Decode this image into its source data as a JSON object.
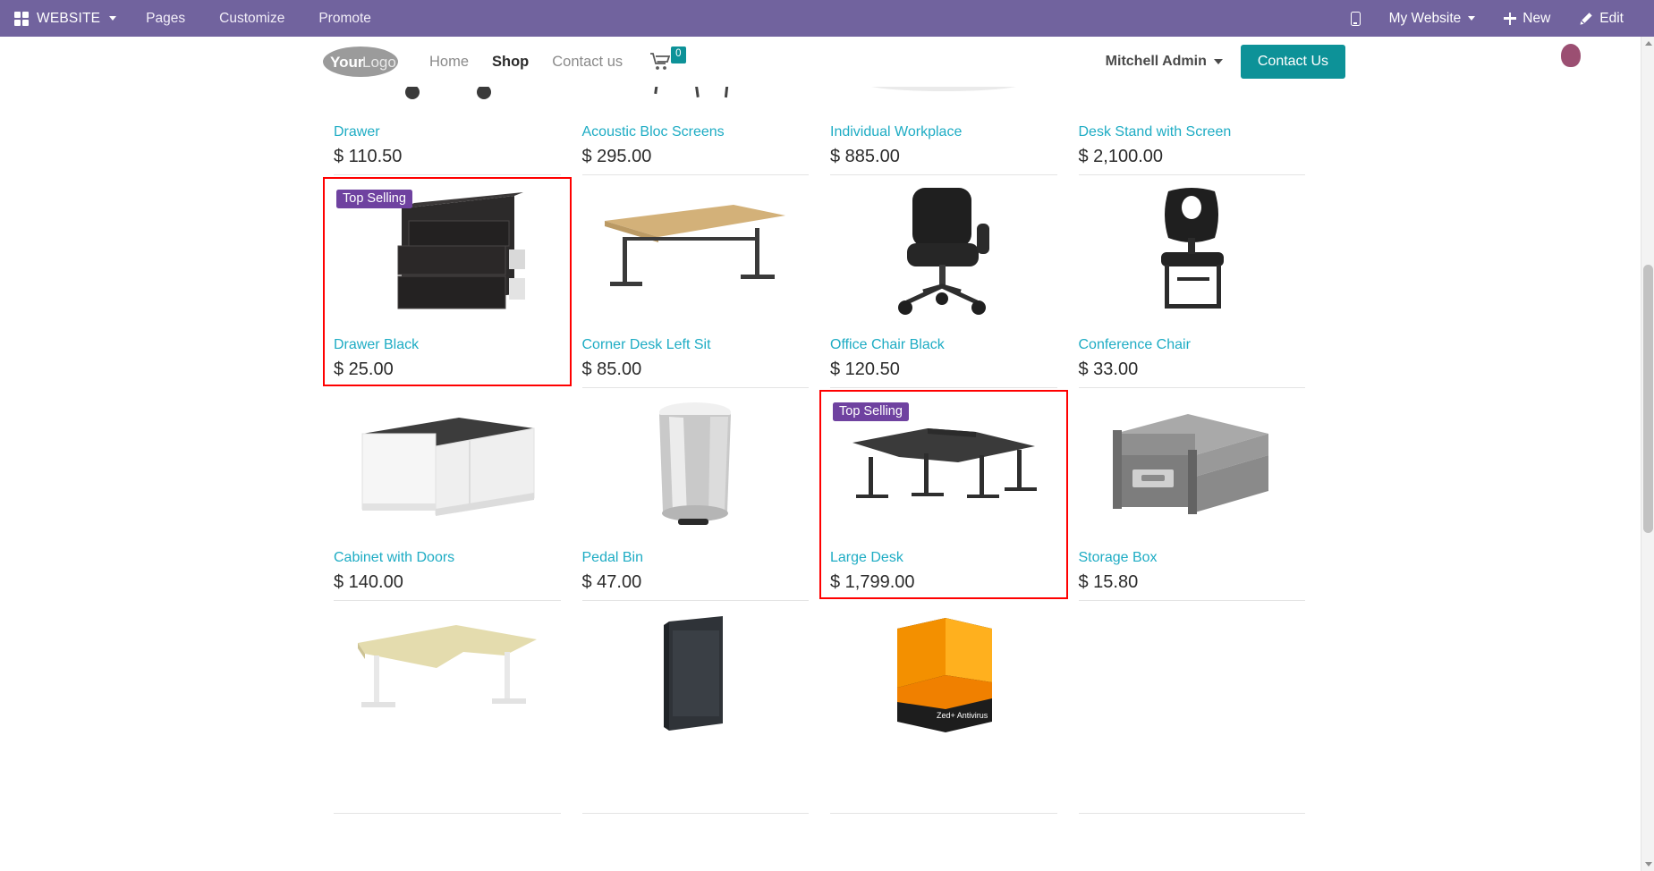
{
  "editor_bar": {
    "brand": {
      "icon": "grid-icon",
      "label": "WEBSITE"
    },
    "menu_items": [
      {
        "label": "Pages"
      },
      {
        "label": "Customize"
      },
      {
        "label": "Promote"
      }
    ],
    "right_items": [
      {
        "icon": "mobile-preview-icon",
        "label": ""
      },
      {
        "label": "My Website",
        "icon": "chevron-down-icon"
      },
      {
        "icon": "plus-icon",
        "label": "New"
      },
      {
        "icon": "pencil-icon",
        "label": "Edit"
      }
    ],
    "background_color": "#71639e"
  },
  "site_header": {
    "logo_text_bold": "Your",
    "logo_text_light": "Logo",
    "nav": [
      {
        "label": "Home",
        "active": false
      },
      {
        "label": "Shop",
        "active": true
      },
      {
        "label": "Contact us",
        "active": false
      }
    ],
    "cart": {
      "icon": "shopping-cart-icon",
      "count": "0",
      "badge_color": "#0d9298"
    },
    "user": {
      "name": "Mitchell Admin"
    },
    "cta_button": {
      "label": "Contact Us",
      "color": "#0d9298"
    }
  },
  "shop": {
    "accent_color": "#1eacc4",
    "badge_color": "#6f42a0",
    "highlight_color": "#ff0000",
    "rows": [
      {
        "products": [
          {
            "name": "Drawer",
            "price": "$ 110.50",
            "badge": "",
            "highlighted": false,
            "image": "drawer-white"
          },
          {
            "name": "Acoustic Bloc Screens",
            "price": "$ 295.00",
            "badge": "",
            "highlighted": false,
            "image": "acoustic-screens"
          },
          {
            "name": "Individual Workplace",
            "price": "$ 885.00",
            "badge": "",
            "highlighted": false,
            "image": "pink-booth"
          },
          {
            "name": "Desk Stand with Screen",
            "price": "$ 2,100.00",
            "badge": "",
            "highlighted": false,
            "image": "desk-stand-screen"
          }
        ]
      },
      {
        "products": [
          {
            "name": "Drawer Black",
            "price": "$ 25.00",
            "badge": "Top Selling",
            "highlighted": true,
            "image": "drawer-black"
          },
          {
            "name": "Corner Desk Left Sit",
            "price": "$ 85.00",
            "badge": "",
            "highlighted": false,
            "image": "corner-desk"
          },
          {
            "name": "Office Chair Black",
            "price": "$ 120.50",
            "badge": "",
            "highlighted": false,
            "image": "office-chair"
          },
          {
            "name": "Conference Chair",
            "price": "$ 33.00",
            "badge": "",
            "highlighted": false,
            "image": "conference-chair"
          }
        ]
      },
      {
        "products": [
          {
            "name": "Cabinet with Doors",
            "price": "$ 140.00",
            "badge": "",
            "highlighted": false,
            "image": "cabinet-doors"
          },
          {
            "name": "Pedal Bin",
            "price": "$ 47.00",
            "badge": "",
            "highlighted": false,
            "image": "pedal-bin"
          },
          {
            "name": "Large Desk",
            "price": "$ 1,799.00",
            "badge": "Top Selling",
            "highlighted": true,
            "image": "large-desk"
          },
          {
            "name": "Storage Box",
            "price": "$ 15.80",
            "badge": "",
            "highlighted": false,
            "image": "storage-box"
          }
        ]
      },
      {
        "products": [
          {
            "name": "",
            "price": "",
            "badge": "",
            "highlighted": false,
            "image": "corner-desk-beige"
          },
          {
            "name": "",
            "price": "",
            "badge": "",
            "highlighted": false,
            "image": "dark-case"
          },
          {
            "name": "",
            "price": "",
            "badge": "",
            "highlighted": false,
            "image": "antivirus-box"
          },
          {
            "name": "",
            "price": "",
            "badge": "",
            "highlighted": false,
            "image": ""
          }
        ]
      }
    ]
  }
}
